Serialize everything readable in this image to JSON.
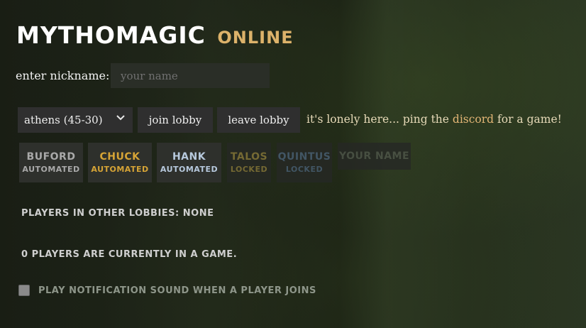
{
  "header": {
    "title": "MYTHOMAGIC",
    "subtitle": "ONLINE"
  },
  "nickname": {
    "label": "enter nickname:",
    "placeholder": "your name",
    "value": ""
  },
  "lobby": {
    "selected": "athens (45-30)",
    "join_label": "join lobby",
    "leave_label": "leave lobby",
    "message_prefix": "it's lonely here... ping the ",
    "message_link": "discord",
    "message_suffix": " for a game!"
  },
  "players": [
    {
      "name": "BUFORD",
      "status": "AUTOMATED",
      "color": "#a9a9a9"
    },
    {
      "name": "CHUCK",
      "status": "AUTOMATED",
      "color": "#d6a436"
    },
    {
      "name": "HANK",
      "status": "AUTOMATED",
      "color": "#b7c9dd"
    },
    {
      "name": "TALOS",
      "status": "LOCKED",
      "color": "#8a7a3a"
    },
    {
      "name": "QUINTUS",
      "status": "LOCKED",
      "color": "#4a6178"
    },
    {
      "name": "YOUR NAME",
      "status": "",
      "color": "#4f564b"
    }
  ],
  "info": {
    "other_lobbies": "PLAYERS IN OTHER LOBBIES: NONE",
    "in_game": "0 PLAYERS ARE CURRENTLY IN A GAME."
  },
  "settings": {
    "sound_label": "PLAY NOTIFICATION SOUND WHEN A PLAYER JOINS",
    "sound_checked": false
  }
}
